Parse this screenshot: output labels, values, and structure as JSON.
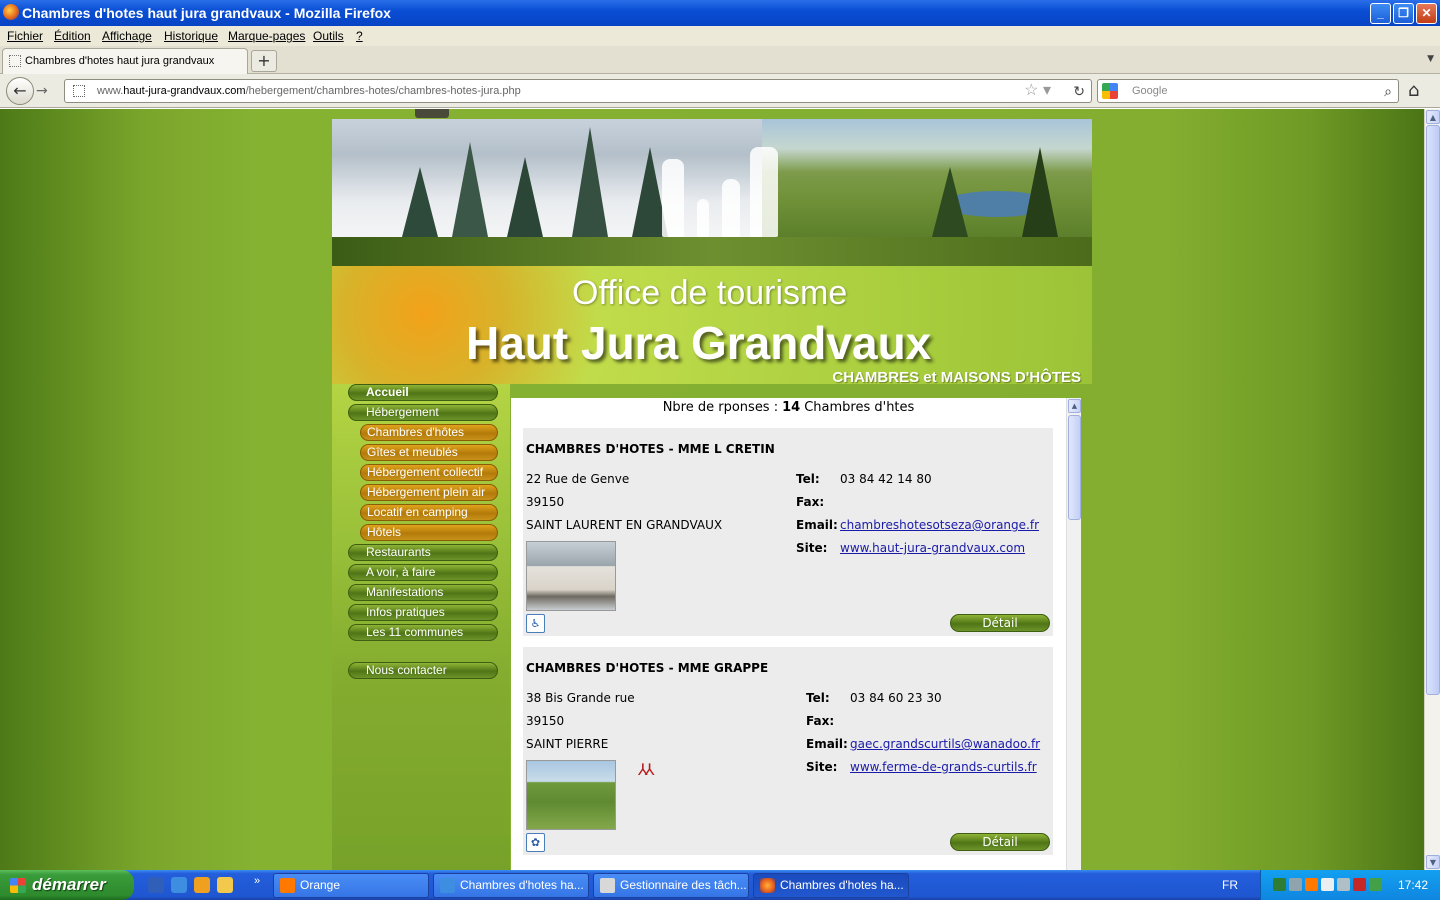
{
  "window": {
    "title": "Chambres d'hotes haut jura grandvaux - Mozilla Firefox"
  },
  "menubar": [
    "Fichier",
    "Édition",
    "Affichage",
    "Historique",
    "Marque-pages",
    "Outils",
    "?"
  ],
  "browser": {
    "tab_title": "Chambres d'hotes haut jura grandvaux",
    "url_prefix": "www.",
    "url_domain": "haut-jura-grandvaux.com",
    "url_path": "/hebergement/chambres-hotes/chambres-hotes-jura.php",
    "search_placeholder": "Google"
  },
  "site": {
    "header_line1": "Office de tourisme",
    "header_line2": "Haut Jura Grandvaux",
    "header_subtitle": "CHAMBRES et MAISONS D'HÔTES",
    "nav": [
      "Accueil",
      "Hébergement",
      "Chambres d'hôtes",
      "Gîtes et meublés",
      "Hébergement collectif",
      "Hébergement plein air",
      "Locatif en camping",
      "Hôtels",
      "Restaurants",
      "A voir, à faire",
      "Manifestations",
      "Infos pratiques",
      "Les 11 communes",
      "Nous contacter"
    ]
  },
  "results": {
    "count_label": "Nbre de rponses :",
    "count": "14",
    "count_unit": "Chambres d'htes",
    "labels": {
      "tel": "Tel:",
      "fax": "Fax:",
      "email": "Email:",
      "site": "Site:",
      "detail": "Détail"
    },
    "listings": [
      {
        "name": "CHAMBRES D'HOTES - MME L CRETIN",
        "street": "22  Rue de Genve",
        "postcode": "39150",
        "city": "SAINT LAURENT EN GRANDVAUX",
        "tel": "03 84 42 14 80",
        "fax": "",
        "email": "chambreshotesotseza@orange.fr",
        "site": "www.haut-jura-grandvaux.com",
        "badge_icon": "wheelchair-icon"
      },
      {
        "name": "CHAMBRES D'HOTES - MME GRAPPE",
        "street": "38  Bis Grande rue",
        "postcode": "39150",
        "city": "SAINT PIERRE",
        "tel": "03 84 60 23 30",
        "fax": "",
        "email": "gaec.grandscurtils@wanadoo.fr",
        "site": "www.ferme-de-grands-curtils.fr",
        "badge_icon": "bienvenue-ferme-icon",
        "label_icon": "epis-icon"
      }
    ]
  },
  "taskbar": {
    "start_label": "démarrer",
    "tasks": [
      "Orange",
      "Chambres d'hotes ha...",
      "Gestionnaire des tâch...",
      "Chambres d'hotes ha..."
    ],
    "language": "FR",
    "clock": "17:42"
  }
}
